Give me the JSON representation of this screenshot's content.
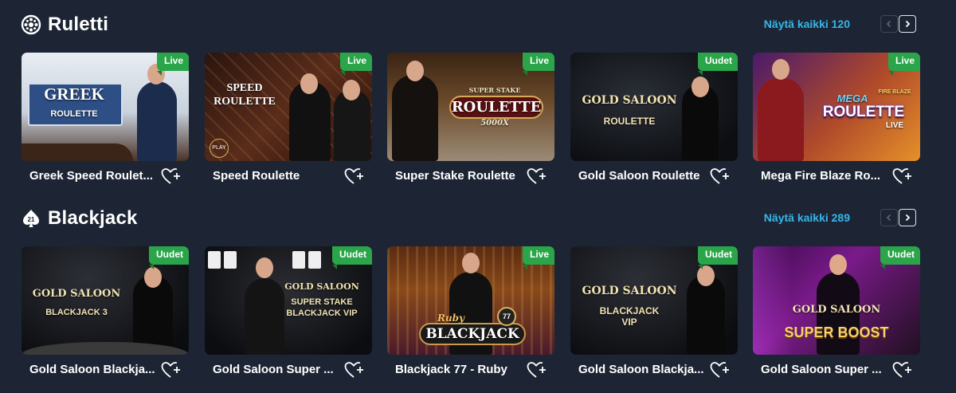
{
  "sections": [
    {
      "title": "Ruletti",
      "icon": "roulette-wheel-icon",
      "show_all": "Näytä kaikki 120",
      "cards": [
        {
          "title": "Greek Speed Roulet...",
          "badge": "Live",
          "art_line1": "GREEK",
          "art_line2": "ROULETTE"
        },
        {
          "title": "Speed Roulette",
          "badge": "Live",
          "art_line1": "SPEED",
          "art_line2": "ROULETTE",
          "art_tag": "PLAY"
        },
        {
          "title": "Super Stake Roulette",
          "badge": "Live",
          "art_line1": "SUPER STAKE",
          "art_line2": "ROULETTE",
          "art_line3": "5000X"
        },
        {
          "title": "Gold Saloon Roulette",
          "badge": "Uudet",
          "art_line1": "GOLD SALOON",
          "art_line2": "ROULETTE"
        },
        {
          "title": "Mega Fire Blaze Ro...",
          "badge": "Live",
          "art_line1": "MEGA",
          "art_line2": "ROULETTE",
          "art_tag": "FIRE BLAZE",
          "art_line3": "LIVE"
        }
      ]
    },
    {
      "title": "Blackjack",
      "icon": "blackjack-21-icon",
      "show_all": "Näytä kaikki 289",
      "cards": [
        {
          "title": "Gold Saloon Blackja...",
          "badge": "Uudet",
          "art_line1": "GOLD SALOON",
          "art_line2": "BLACKJACK 3"
        },
        {
          "title": "Gold Saloon Super ...",
          "badge": "Uudet",
          "art_line1": "GOLD SALOON",
          "art_line2": "SUPER STAKE",
          "art_line3": "BLACKJACK VIP"
        },
        {
          "title": "Blackjack 77 - Ruby",
          "badge": "Live",
          "art_line1": "Ruby",
          "art_line2": "BLACKJACK",
          "art_tag": "77"
        },
        {
          "title": "Gold Saloon Blackja...",
          "badge": "Uudet",
          "art_line1": "GOLD SALOON",
          "art_line2": "BLACKJACK",
          "art_line3": "VIP"
        },
        {
          "title": "Gold Saloon Super ...",
          "badge": "Uudet",
          "art_line1": "GOLD SALOON",
          "art_line2": "SUPER BOOST"
        }
      ]
    }
  ],
  "colors": {
    "background": "#1d2534",
    "link": "#36b6ea",
    "badge": "#2aa54a",
    "gold": "#f2e3b3"
  }
}
